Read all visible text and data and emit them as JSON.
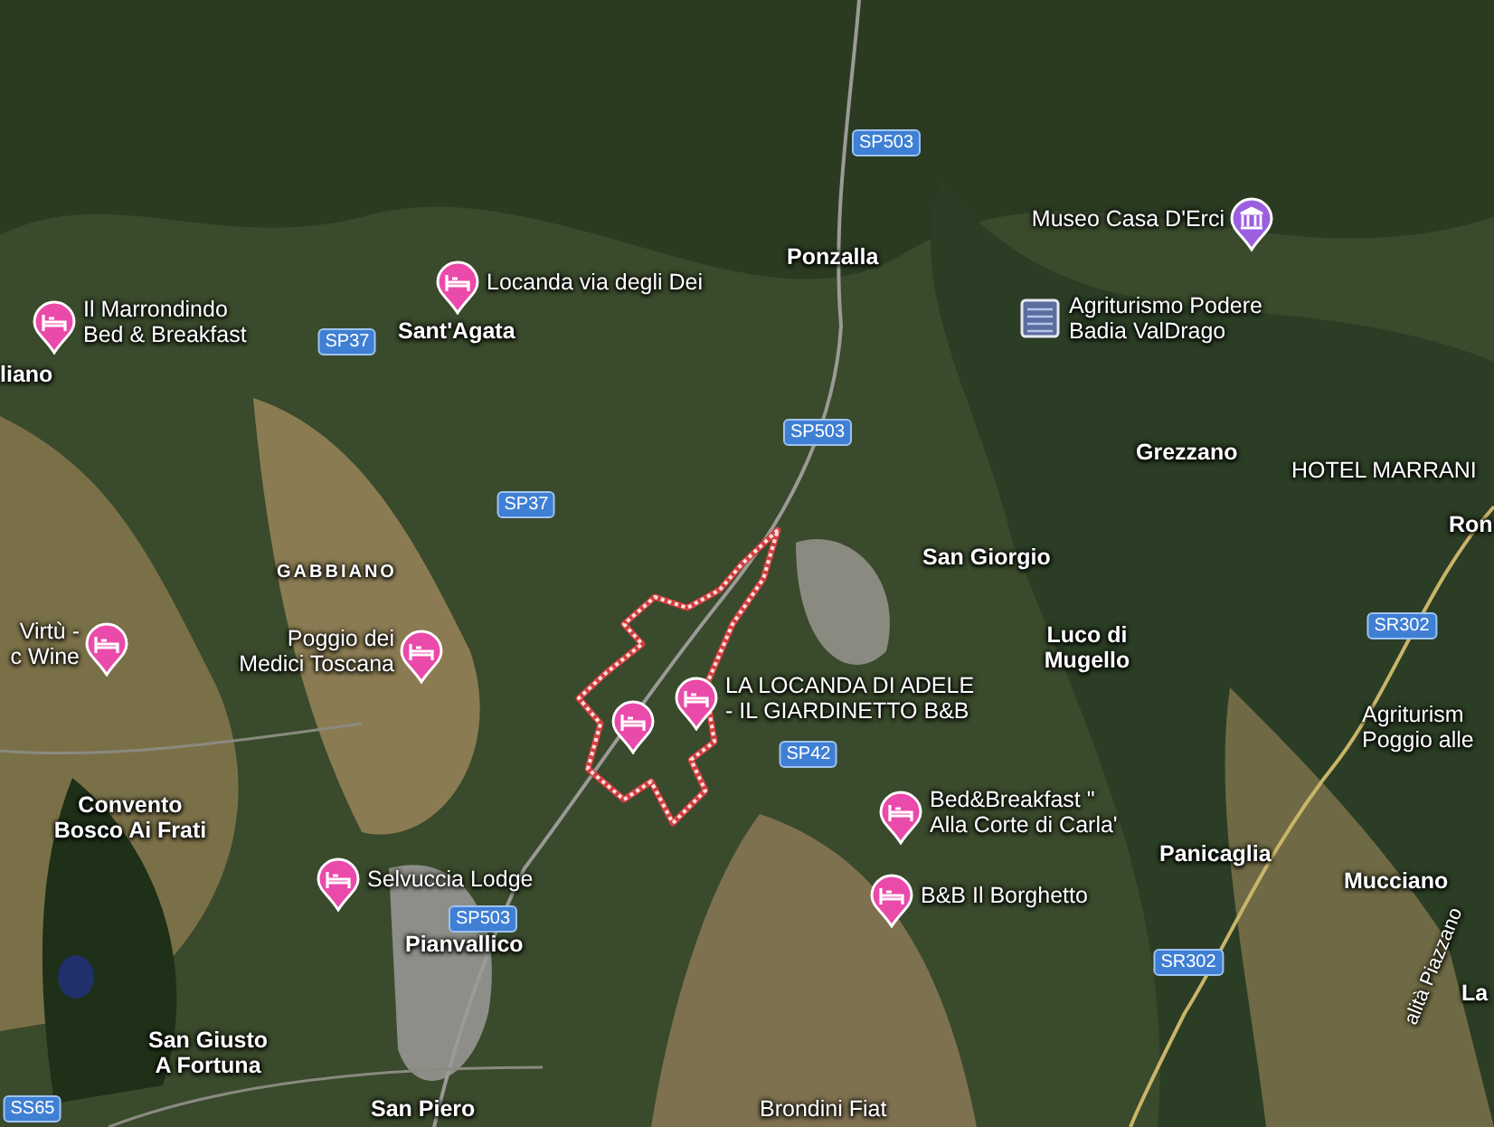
{
  "map": {
    "road_shields": [
      "SP503",
      "SP37",
      "SP503",
      "SP37",
      "SP42",
      "SP503",
      "SR302",
      "SR302",
      "SS65"
    ],
    "place_labels": [
      {
        "kind": "town",
        "text": "Ponzalla"
      },
      {
        "kind": "town",
        "text": "Sant'Agata"
      },
      {
        "kind": "town",
        "text": "liano"
      },
      {
        "kind": "town",
        "text": "Grezzano"
      },
      {
        "kind": "place",
        "text": "HOTEL MARRANI"
      },
      {
        "kind": "town",
        "text": "Ron"
      },
      {
        "kind": "town",
        "text": "San Giorgio"
      },
      {
        "kind": "area",
        "text": "GABBIANO"
      },
      {
        "kind": "town",
        "text": "Luco di\nMugello"
      },
      {
        "kind": "place",
        "text": "Agriturism\nPoggio alle"
      },
      {
        "kind": "town",
        "text": "Convento\nBosco Ai Frati"
      },
      {
        "kind": "town",
        "text": "Panicaglia"
      },
      {
        "kind": "town",
        "text": "Mucciano"
      },
      {
        "kind": "town",
        "text": "Pianvallico"
      },
      {
        "kind": "town",
        "text": "La"
      },
      {
        "kind": "town",
        "text": "San Giusto\nA Fortuna"
      },
      {
        "kind": "street",
        "text": "alità Piazzano"
      },
      {
        "kind": "town",
        "text": "San Piero"
      },
      {
        "kind": "place",
        "text": "Brondini Fiat"
      }
    ],
    "pins": [
      {
        "kind": "museum",
        "label": "Museo Casa D'Erci"
      },
      {
        "kind": "hotel",
        "label": "Locanda via degli Dei"
      },
      {
        "kind": "hotel",
        "label": "Il Marrondindo\nBed & Breakfast"
      },
      {
        "kind": "photo",
        "label": "Agriturismo Podere\nBadia ValDrago"
      },
      {
        "kind": "hotel",
        "label": "Virtù -\nc Wine"
      },
      {
        "kind": "hotel",
        "label": "Poggio dei\nMedici Toscana"
      },
      {
        "kind": "hotel"
      },
      {
        "kind": "hotel",
        "label": "LA LOCANDA DI ADELE\n- IL GIARDINETTO B&B"
      },
      {
        "kind": "hotel",
        "label": "Bed&Breakfast \"\nAlla Corte di Carla'"
      },
      {
        "kind": "hotel",
        "label": "Selvuccia Lodge"
      },
      {
        "kind": "hotel",
        "label": "B&B Il Borghetto"
      }
    ]
  }
}
